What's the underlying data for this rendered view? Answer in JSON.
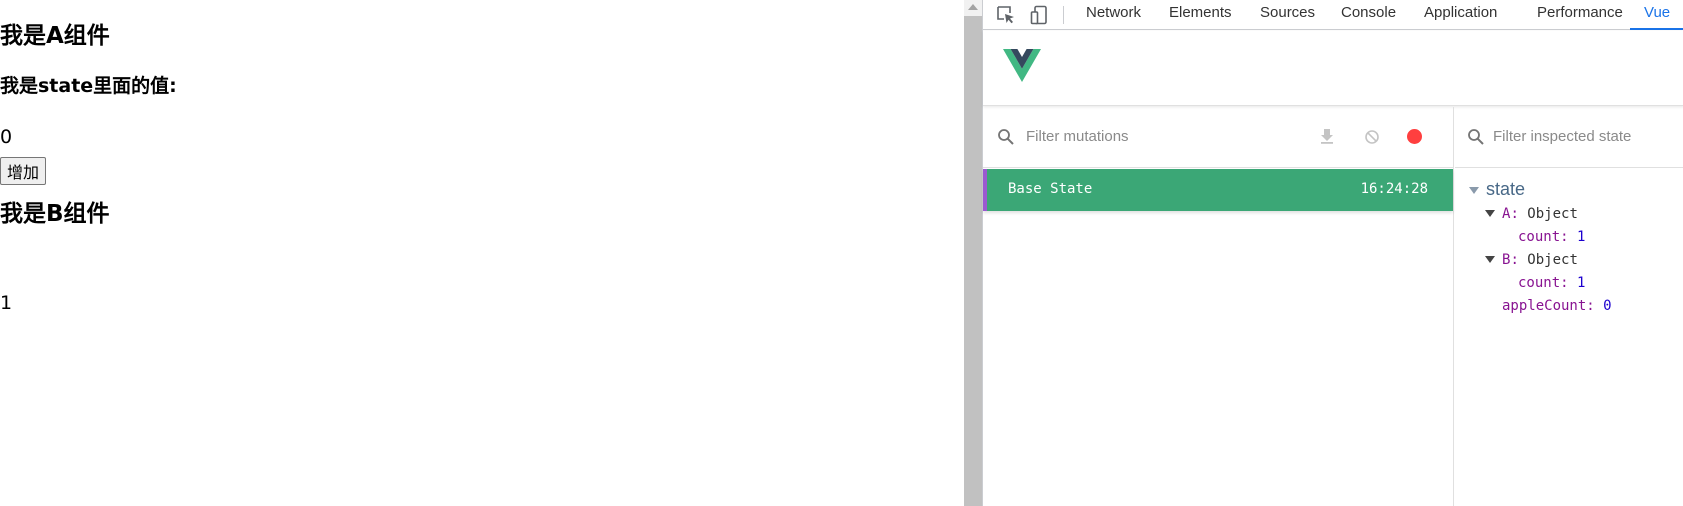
{
  "page": {
    "a_title": "我是A组件",
    "state_label": "我是state里面的值:",
    "a_value": "0",
    "add_button": "增加",
    "b_title": "我是B组件",
    "b_value": "1"
  },
  "devtools": {
    "tabs": [
      "Network",
      "Elements",
      "Sources",
      "Console",
      "Application",
      "Performance",
      "Vue"
    ],
    "active_tab": "Vue",
    "icons": [
      "inspect-element-icon",
      "device-toolbar-icon"
    ],
    "accent_color": "#1a73e8"
  },
  "vue": {
    "brand_colors": {
      "green": "#41b883",
      "dark": "#35495e"
    },
    "mutations": {
      "filter_placeholder": "Filter mutations",
      "icons": [
        "export-icon",
        "clear-icon",
        "record-icon"
      ],
      "record_color": "#ff3f3f",
      "base_state": {
        "label": "Base State",
        "time": "16:24:28",
        "row_color": "#3ba776"
      }
    },
    "inspector": {
      "filter_placeholder": "Filter inspected state",
      "root": "state",
      "A": {
        "key": "A",
        "type": "Object",
        "count_key": "count",
        "count_value": "1"
      },
      "B": {
        "key": "B",
        "type": "Object",
        "count_key": "count",
        "count_value": "1"
      },
      "apple": {
        "key": "appleCount",
        "value": "0"
      }
    }
  }
}
